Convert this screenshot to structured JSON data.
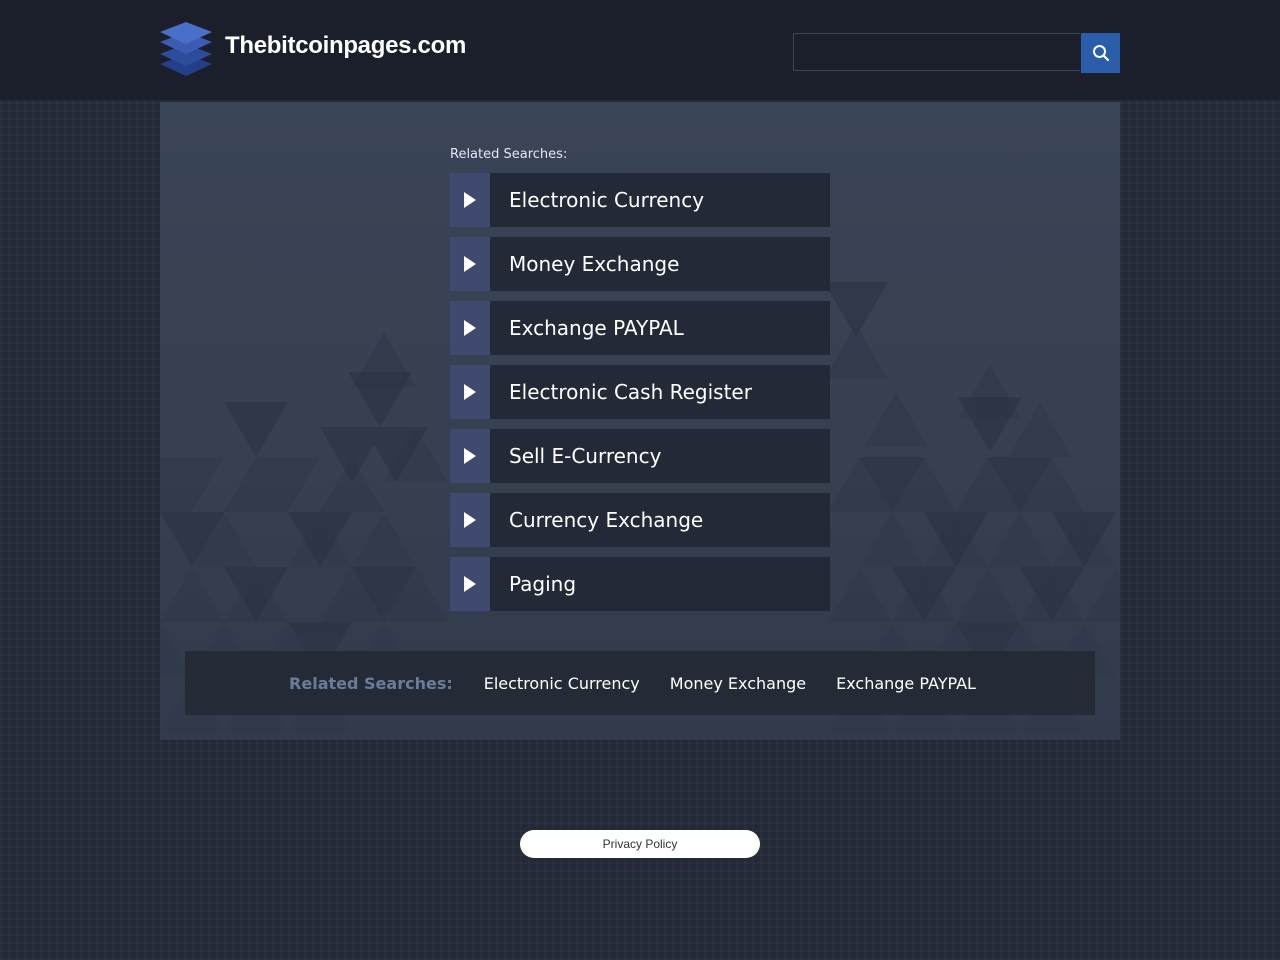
{
  "header": {
    "site_title": "Thebitcoinpages.com",
    "logo_icon": "stacked-layers-icon",
    "search": {
      "value": "",
      "placeholder": "",
      "button_icon": "search-icon",
      "button_color": "#2a5daa"
    }
  },
  "main": {
    "related_label": "Related Searches:",
    "links": [
      {
        "label": "Electronic Currency"
      },
      {
        "label": "Money Exchange"
      },
      {
        "label": "Exchange PAYPAL"
      },
      {
        "label": "Electronic Cash Register"
      },
      {
        "label": "Sell E-Currency"
      },
      {
        "label": "Currency Exchange"
      },
      {
        "label": "Paging"
      }
    ],
    "arrow_icon": "play-arrow-icon"
  },
  "bottom_bar": {
    "label": "Related Searches:",
    "links": [
      {
        "label": "Electronic Currency"
      },
      {
        "label": "Money Exchange"
      },
      {
        "label": "Exchange PAYPAL"
      }
    ]
  },
  "footer": {
    "privacy_label": "Privacy Policy"
  },
  "colors": {
    "page_bg": "#232937",
    "header_bg": "#1a1f2b",
    "panel_bg": "#3a4457",
    "link_bg": "#232937",
    "arrow_bg": "#3f4a6e",
    "accent": "#2a5daa",
    "bottom_label": "#6b7c99"
  }
}
